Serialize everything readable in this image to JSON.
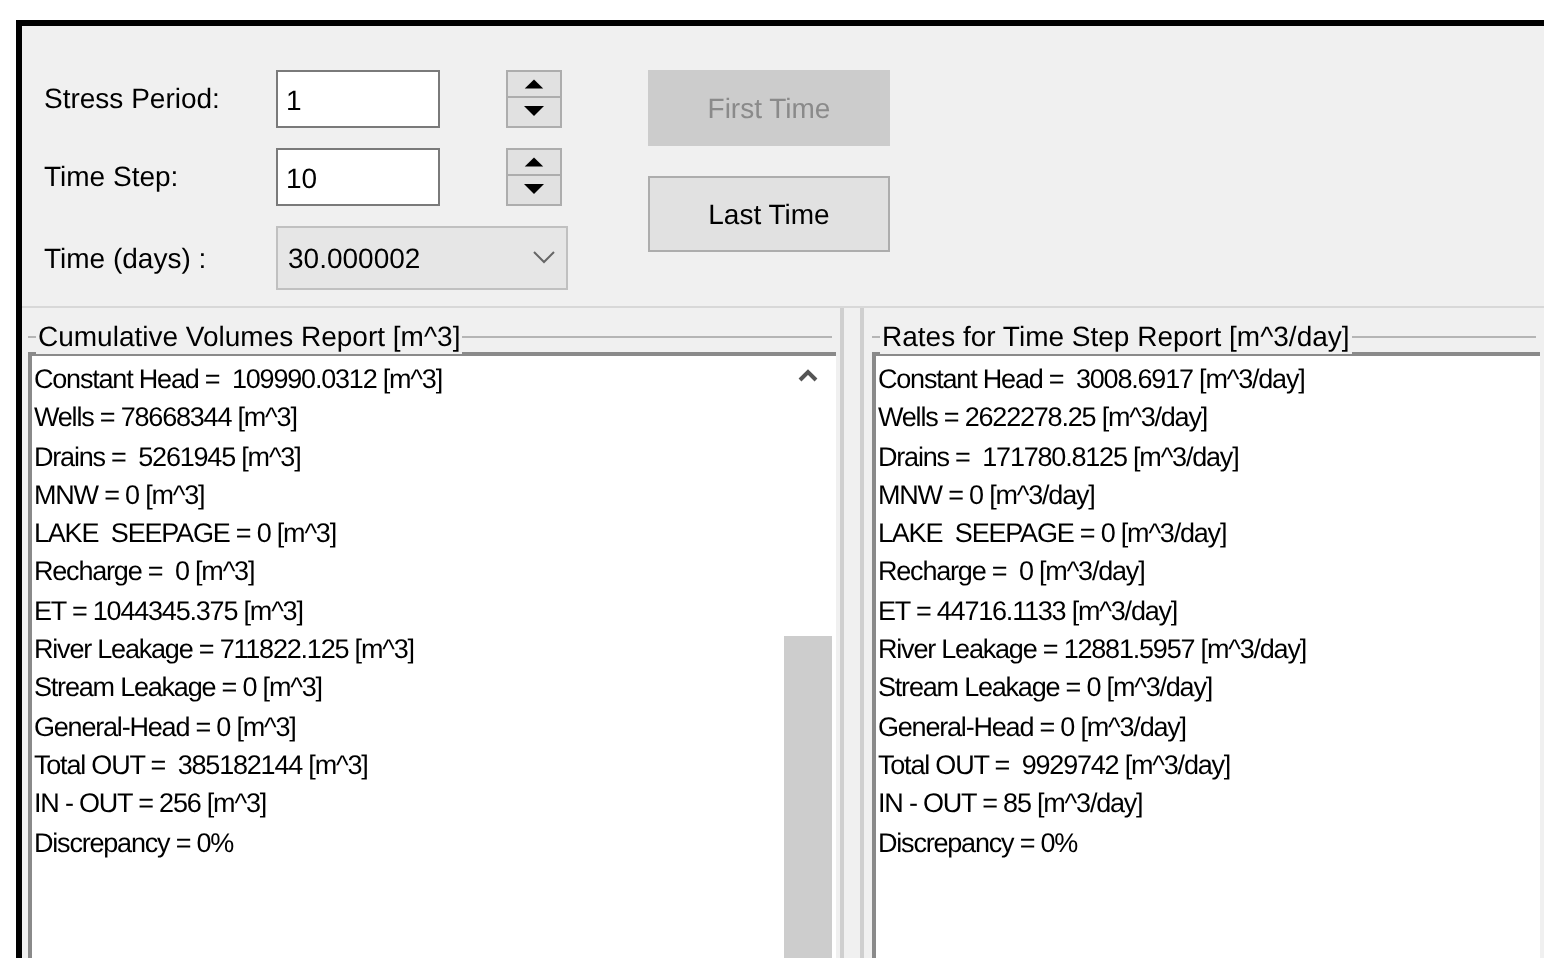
{
  "controls": {
    "stress_period": {
      "label": "Stress Period:",
      "value": "1"
    },
    "time_step": {
      "label": "Time Step:",
      "value": "10"
    },
    "time": {
      "label": "Time (days) :",
      "value": "30.000002"
    },
    "buttons": [
      {
        "label": "First Time",
        "disabled": true
      },
      {
        "label": "Last Time",
        "disabled": false
      }
    ]
  },
  "reports": [
    {
      "title": "Cumulative Volumes Report [m^3]",
      "scrollbar": true,
      "lines": [
        "Constant Head =  109990.0312 [m^3]",
        "Wells = 78668344 [m^3]",
        "Drains =  5261945 [m^3]",
        "MNW = 0 [m^3]",
        "LAKE  SEEPAGE = 0 [m^3]",
        "Recharge =  0 [m^3]",
        "ET = 1044345.375 [m^3]",
        "River Leakage = 711822.125 [m^3]",
        "Stream Leakage = 0 [m^3]",
        "General-Head = 0 [m^3]",
        "Total OUT =  385182144 [m^3]",
        "IN - OUT = 256 [m^3]",
        "Discrepancy = 0%"
      ]
    },
    {
      "title": "Rates for Time Step Report [m^3/day]",
      "scrollbar": false,
      "lines": [
        "Constant Head =  3008.6917 [m^3/day]",
        "Wells = 2622278.25 [m^3/day]",
        "Drains =  171780.8125 [m^3/day]",
        "MNW = 0 [m^3/day]",
        "LAKE  SEEPAGE = 0 [m^3/day]",
        "Recharge =  0 [m^3/day]",
        "ET = 44716.1133 [m^3/day]",
        "River Leakage = 12881.5957 [m^3/day]",
        "Stream Leakage = 0 [m^3/day]",
        "General-Head = 0 [m^3/day]",
        "Total OUT =  9929742 [m^3/day]",
        "IN - OUT = 85 [m^3/day]",
        "Discrepancy = 0%"
      ]
    }
  ]
}
